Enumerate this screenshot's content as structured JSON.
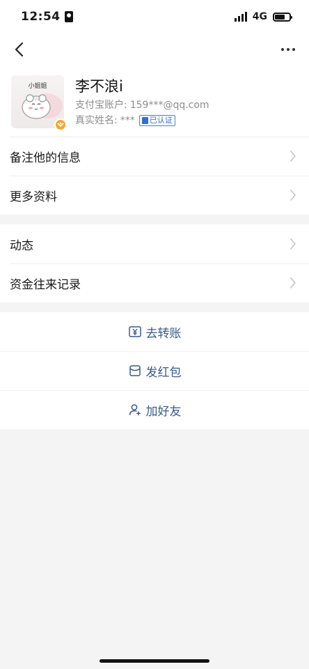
{
  "status_bar": {
    "time": "12:54",
    "network": "4G"
  },
  "nav": {
    "back_icon": "chevron-left-icon",
    "more_icon": "ellipsis-icon"
  },
  "profile": {
    "avatar_label": "小姐姐",
    "name": "李不浪i",
    "account_label": "支付宝账户:",
    "account_value": "159***@qq.com",
    "realname_label": "真实姓名:",
    "realname_value": "***",
    "verified_label": "已认证"
  },
  "menu_group_1": [
    {
      "label": "备注他的信息"
    },
    {
      "label": "更多资料"
    }
  ],
  "menu_group_2": [
    {
      "label": "动态"
    },
    {
      "label": "资金往来记录"
    }
  ],
  "actions": [
    {
      "label": "去转账",
      "icon": "yuan-transfer-icon"
    },
    {
      "label": "发红包",
      "icon": "red-envelope-icon"
    },
    {
      "label": "加好友",
      "icon": "add-friend-icon"
    }
  ],
  "colors": {
    "accent": "#3a5a8c",
    "verified": "#2f6fd9",
    "badge": "#f3a73a"
  }
}
